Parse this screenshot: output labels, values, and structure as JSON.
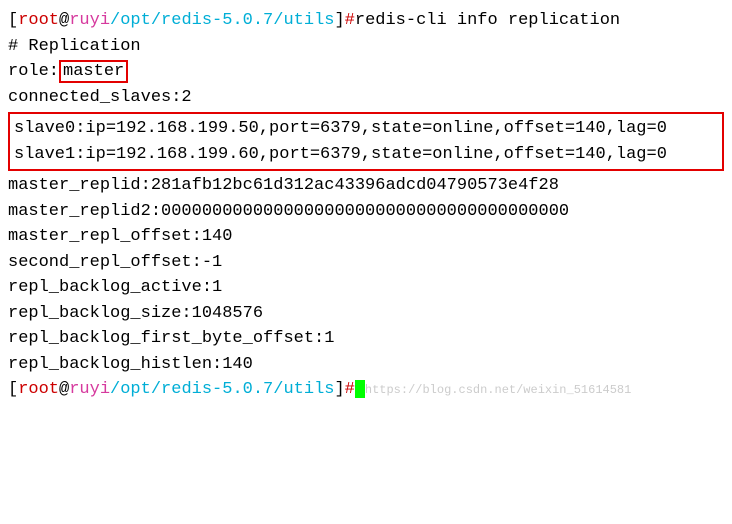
{
  "prompt1": {
    "open": "[",
    "user": "root",
    "at": "@",
    "host": "ruyi",
    "path": "/opt/redis-5.0.7/utils",
    "close": "]",
    "hash": "#",
    "cmd": "redis-cli info replication"
  },
  "out": {
    "header": "# Replication",
    "role_prefix": "role:",
    "role_value": "master",
    "connected": "connected_slaves:2",
    "slave0": "slave0:ip=192.168.199.50,port=6379,state=online,offset=140,lag=0",
    "slave1": "slave1:ip=192.168.199.60,port=6379,state=online,offset=140,lag=0",
    "replid": "master_replid:281afb12bc61d312ac43396adcd04790573e4f28",
    "replid2": "master_replid2:0000000000000000000000000000000000000000",
    "repl_offset": "master_repl_offset:140",
    "second_offset": "second_repl_offset:-1",
    "backlog_active": "repl_backlog_active:1",
    "backlog_size": "repl_backlog_size:1048576",
    "backlog_first": "repl_backlog_first_byte_offset:1",
    "backlog_histlen": "repl_backlog_histlen:140"
  },
  "prompt2": {
    "open": "[",
    "user": "root",
    "at": "@",
    "host": "ruyi",
    "path": "/opt/redis-5.0.7/utils",
    "close": "]",
    "hash": "#"
  },
  "watermark": "https://blog.csdn.net/weixin_51614581"
}
